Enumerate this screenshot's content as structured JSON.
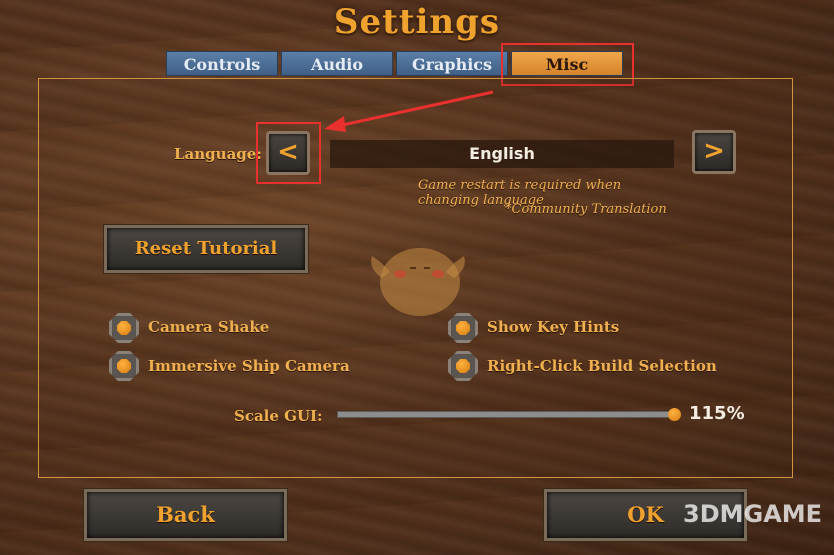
{
  "title": "Settings",
  "tabs": [
    {
      "label": "Controls"
    },
    {
      "label": "Audio"
    },
    {
      "label": "Graphics"
    },
    {
      "label": "Misc",
      "active": true
    }
  ],
  "language": {
    "label": "Language:",
    "value": "English",
    "prev_icon": "<",
    "next_icon": ">",
    "note_restart": "Game restart is required when changing language",
    "note_community": "*Community Translation"
  },
  "reset_tutorial_label": "Reset Tutorial",
  "options": [
    {
      "label": "Camera Shake",
      "checked": true
    },
    {
      "label": "Show Key Hints",
      "checked": true
    },
    {
      "label": "Immersive Ship Camera",
      "checked": true
    },
    {
      "label": "Right-Click Build Selection",
      "checked": true
    }
  ],
  "scale_gui": {
    "label": "Scale GUI:",
    "value_text": "115%",
    "fill_fraction": 1.0
  },
  "footer": {
    "back_label": "Back",
    "ok_label": "OK"
  },
  "watermark": "3DMGAME",
  "colors": {
    "accent": "#f0a22e",
    "tab_blue": "#4a6c94",
    "highlight": "#e8302f"
  },
  "icons": [
    "chevron-left-icon",
    "chevron-right-icon",
    "mascot-bird-icon",
    "arrow-annotation-icon"
  ]
}
